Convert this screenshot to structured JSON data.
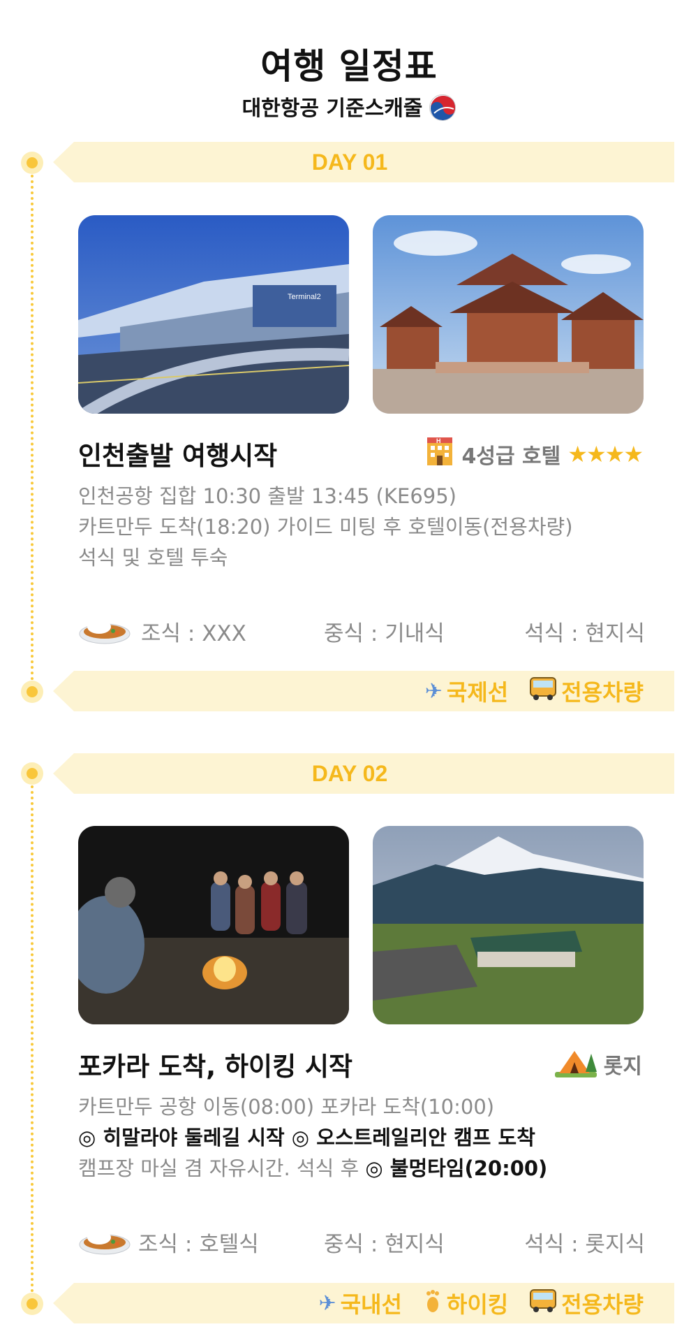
{
  "header": {
    "title": "여행 일정표",
    "subtitle": "대한항공 기준스캐줄"
  },
  "days": [
    {
      "label": "DAY 01",
      "heading": "인천출발 여행시작",
      "lodging": {
        "text": "4성급 호텔",
        "stars": "★★★★",
        "icon": "hotel-icon"
      },
      "desc_lines": [
        "인천공항 집합 10:30 출발 13:45 (KE695)",
        "카트만두 도착(18:20) 가이드 미팅 후 호텔이동(전용차량)",
        "석식 및 호텔 투숙"
      ],
      "meals": {
        "breakfast": "조식 : XXX",
        "lunch": "중식 : 기내식",
        "dinner": "석식 : 현지식"
      },
      "transport": [
        {
          "icon": "airplane-icon",
          "glyph": "✈",
          "label": "국제선"
        },
        {
          "icon": "bus-icon",
          "glyph": "🚌",
          "label": "전용차량"
        }
      ]
    },
    {
      "label": "DAY 02",
      "heading": "포카라 도착, 하이킹 시작",
      "lodging": {
        "text": "롯지",
        "icon": "camping-icon"
      },
      "desc": {
        "line1": "카트만두 공항 이동(08:00) 포카라 도착(10:00)",
        "line2": "◎ 히말라야 둘레길 시작 ◎ 오스트레일리안 캠프 도착",
        "line3_plain": "캠프장 마실 겸 자유시간. 석식 후 ",
        "line3_bold": "◎ 불멍타임(20:00)"
      },
      "meals": {
        "breakfast": "조식 : 호텔식",
        "lunch": "중식 : 현지식",
        "dinner": "석식 : 롯지식"
      },
      "transport": [
        {
          "icon": "airplane-icon",
          "glyph": "✈",
          "label": "국내선"
        },
        {
          "icon": "footprint-icon",
          "glyph": "👣",
          "label": "하이킹"
        },
        {
          "icon": "bus-icon",
          "glyph": "🚌",
          "label": "전용차량"
        }
      ]
    }
  ],
  "colors": {
    "accent": "#f5b81c",
    "banner_bg": "#fdf4d3",
    "timeline": "#f9c93a",
    "text_gray": "#8a8a8a"
  }
}
